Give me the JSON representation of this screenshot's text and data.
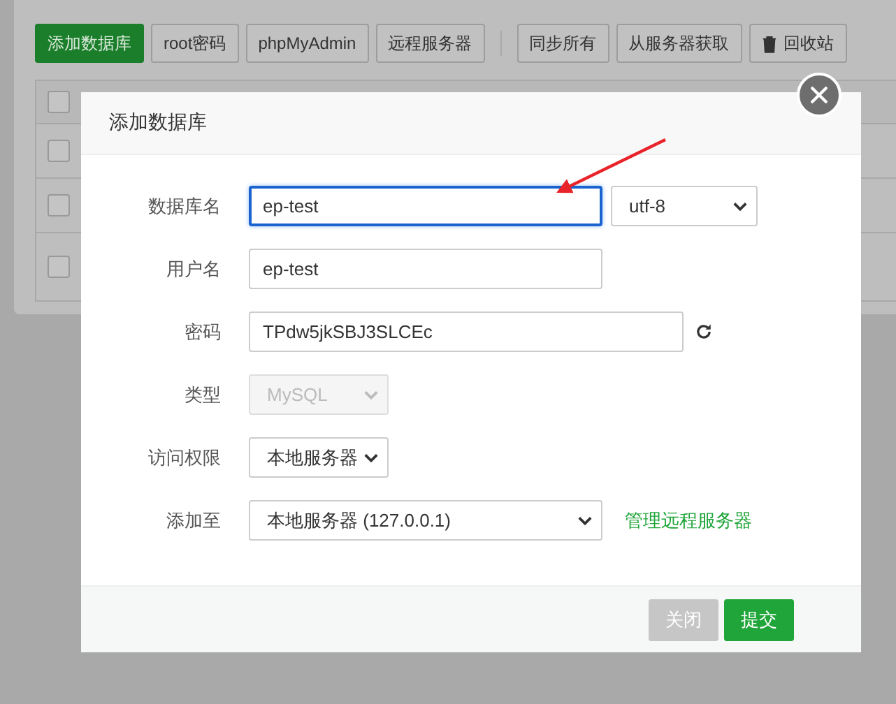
{
  "toolbar": {
    "buttons": [
      {
        "label": "添加数据库",
        "kind": "primary"
      },
      {
        "label": "root密码",
        "kind": "default"
      },
      {
        "label": "phpMyAdmin",
        "kind": "default"
      },
      {
        "label": "远程服务器",
        "kind": "default"
      },
      {
        "kind": "separator"
      },
      {
        "label": "同步所有",
        "kind": "default"
      },
      {
        "label": "从服务器获取",
        "kind": "default"
      },
      {
        "label": "回收站",
        "kind": "trash"
      }
    ]
  },
  "table": {
    "rows": [
      {
        "checked": false
      },
      {
        "checked": false
      },
      {
        "checked": false
      },
      {
        "checked": false
      }
    ]
  },
  "dialog": {
    "title": "添加数据库",
    "rows": [
      {
        "label": "数据库名",
        "controls": [
          {
            "kind": "text",
            "value": "ep-test",
            "focused": true
          },
          {
            "kind": "select",
            "value": "utf-8"
          }
        ]
      },
      {
        "label": "用户名",
        "controls": [
          {
            "kind": "text",
            "value": "ep-test",
            "focused": false
          }
        ]
      },
      {
        "label": "密码",
        "controls": [
          {
            "kind": "text-wide",
            "value": "TPdw5jkSBJ3SLCEc",
            "focused": false
          },
          {
            "kind": "refresh"
          }
        ]
      },
      {
        "label": "类型",
        "controls": [
          {
            "kind": "compact-select",
            "value": "MySQL",
            "disabled": true
          }
        ]
      },
      {
        "label": "访问权限",
        "controls": [
          {
            "kind": "compact-select",
            "value": "本地服务器",
            "disabled": false
          }
        ]
      },
      {
        "label": "添加至",
        "controls": [
          {
            "kind": "wide-select",
            "value": "本地服务器 (127.0.0.1)"
          },
          {
            "kind": "link",
            "label": "管理远程服务器"
          }
        ]
      }
    ],
    "buttons": [
      {
        "label": "关闭",
        "kind": "secondary"
      },
      {
        "label": "提交",
        "kind": "primary"
      }
    ]
  },
  "annotation": {
    "kind": "arrow"
  }
}
